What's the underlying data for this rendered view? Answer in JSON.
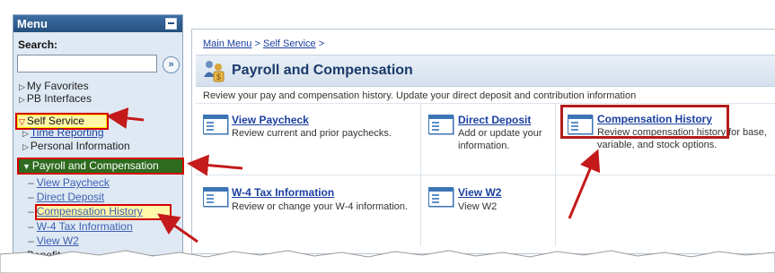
{
  "menu": {
    "title": "Menu",
    "search_label": "Search:",
    "search_value": "",
    "search_go": "»",
    "items": {
      "my_favorites": "My Favorites",
      "pb_interfaces": "PB Interfaces",
      "self_service": "Self Service",
      "time_reporting": "Time Reporting",
      "personal_information": "Personal Information",
      "payroll_compensation": "Payroll and Compensation",
      "view_paycheck": "View Paycheck",
      "direct_deposit": "Direct Deposit",
      "compensation_history": "Compensation History",
      "w4_tax_information": "W-4 Tax Information",
      "view_w2": "View W2",
      "benefits": "Benefits"
    }
  },
  "content": {
    "breadcrumb": {
      "main_menu": "Main Menu",
      "separator": ">",
      "self_service": "Self Service",
      "trailing": ">"
    },
    "page_title": "Payroll and Compensation",
    "description": "Review your pay and compensation history. Update your direct deposit and contribution information",
    "tiles": [
      {
        "title": "View Paycheck",
        "desc": "Review current and prior paychecks."
      },
      {
        "title": "Direct Deposit",
        "desc": "Add or update your information."
      },
      {
        "title": "Compensation History",
        "desc": "Review compensation history for base, variable, and stock options."
      },
      {
        "title": "W-4 Tax Information",
        "desc": "Review or change your W-4 information."
      },
      {
        "title": "View W2",
        "desc": "View W2"
      }
    ]
  },
  "colors": {
    "highlight_border": "#d40000",
    "highlight_fill": "#fff8a8",
    "arrow": "#c41a1a",
    "menu_header": "#24507f",
    "payroll_selected": "#2f6b1f"
  }
}
